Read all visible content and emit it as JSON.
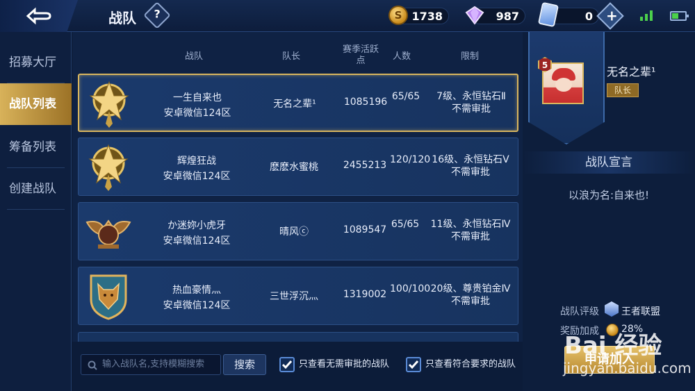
{
  "header": {
    "title": "战队",
    "help": "?",
    "coins": "1738",
    "gems": "987",
    "cards": "0",
    "add": "+"
  },
  "sidebar": {
    "items": [
      {
        "label": "招募大厅",
        "active": false
      },
      {
        "label": "战队列表",
        "active": true
      },
      {
        "label": "筹备列表",
        "active": false
      },
      {
        "label": "创建战队",
        "active": false
      }
    ]
  },
  "columns": {
    "team": "战队",
    "captain": "队长",
    "activity_l1": "赛季活跃",
    "activity_l2": "点",
    "members": "人数",
    "limit": "限制"
  },
  "rows": [
    {
      "name": "一生自来也",
      "server": "安卓微信124区",
      "captain": "无名之辈¹",
      "activity": "1085196",
      "members": "65/65",
      "limit": "7级、永恒钻石Ⅱ",
      "approval": "不需审批",
      "emblem": "gold-crest-icon"
    },
    {
      "name": "辉煌狂战",
      "server": "安卓微信124区",
      "captain": "麽麽水蜜桃",
      "activity": "2455213",
      "members": "120/120",
      "limit": "16级、永恒钻石Ⅴ",
      "approval": "不需审批",
      "emblem": "gold-crest-icon"
    },
    {
      "name": "か迷妳小虎牙",
      "server": "安卓微信124区",
      "captain": "晴风ⓒ",
      "activity": "1089547",
      "members": "65/65",
      "limit": "11级、永恒钻石Ⅳ",
      "approval": "不需审批",
      "emblem": "eagle-crest-icon"
    },
    {
      "name": "热血豪情灬",
      "server": "安卓微信124区",
      "captain": "三世浮沉灬",
      "activity": "1319002",
      "members": "100/100",
      "limit": "20级、尊贵铂金Ⅳ",
      "approval": "不需审批",
      "emblem": "wolf-shield-icon"
    }
  ],
  "search": {
    "placeholder": "输入战队名,支持模糊搜索",
    "button": "搜索",
    "filter_no_approval": "只查看无需审批的战队",
    "filter_eligible": "只查看符合要求的战队"
  },
  "detail": {
    "level": "5",
    "captain_name": "无名之辈¹",
    "captain_role": "队长",
    "declaration_title": "战队宣言",
    "declaration": "以浪为名:自来也!",
    "rating_label": "战队评级",
    "rating_value": "王者联盟",
    "reward_label": "奖励加成",
    "reward_value": "28%",
    "apply_button": "申请加入"
  },
  "watermark": {
    "text": "Bai 经验",
    "url": "jingyan.baidu.com"
  },
  "colors": {
    "accent_gold": "#d9b65e",
    "panel_blue": "#17335f",
    "background": "#0b1830"
  }
}
